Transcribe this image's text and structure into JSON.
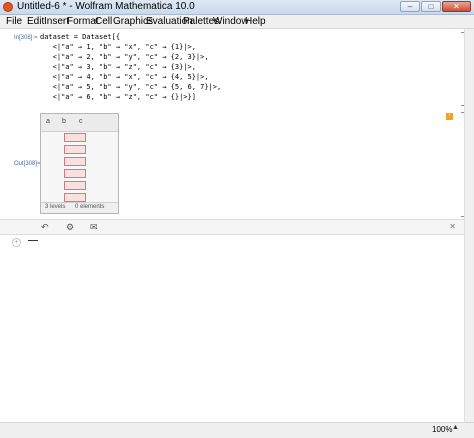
{
  "window": {
    "title": "Untitled-6 * - Wolfram Mathematica 10.0",
    "minimize_glyph": "–",
    "maximize_glyph": "□",
    "close_glyph": "✕"
  },
  "menu": [
    "File",
    "Edit",
    "Insert",
    "Format",
    "Cell",
    "Graphics",
    "Evaluation",
    "Palettes",
    "Window",
    "Help"
  ],
  "input": {
    "label": "In[308]:=",
    "lines": [
      "dataset = Dataset[{",
      "   <|\"a\" → 1, \"b\" → \"x\", \"c\" → {1}|>,",
      "   <|\"a\" → 2, \"b\" → \"y\", \"c\" → {2, 3}|>,",
      "   <|\"a\" → 3, \"b\" → \"z\", \"c\" → {3}|>,",
      "   <|\"a\" → 4, \"b\" → \"x\", \"c\" → {4, 5}|>,",
      "   <|\"a\" → 5, \"b\" → \"y\", \"c\" → {5, 6, 7}|>,",
      "   <|\"a\" → 6, \"b\" → \"z\", \"c\" → {}|>}]"
    ]
  },
  "output": {
    "label": "Out[308]=",
    "columns": [
      "a",
      "b",
      "c"
    ],
    "row_count": 6,
    "footer_levels": "3 levels",
    "footer_elements": "0 elements"
  },
  "suggestions_bar": {
    "icons": [
      "undo-icon",
      "gear-icon",
      "comment-icon"
    ],
    "close_glyph": "✕"
  },
  "status": {
    "zoom": "100%",
    "zoom_arrow": "▲"
  },
  "colors": {
    "bracket_blue": "#6f93c8",
    "label_blue": "#4e6d9c",
    "cell_highlight": "#f4a020",
    "error_pink": "#fbe0e0"
  }
}
